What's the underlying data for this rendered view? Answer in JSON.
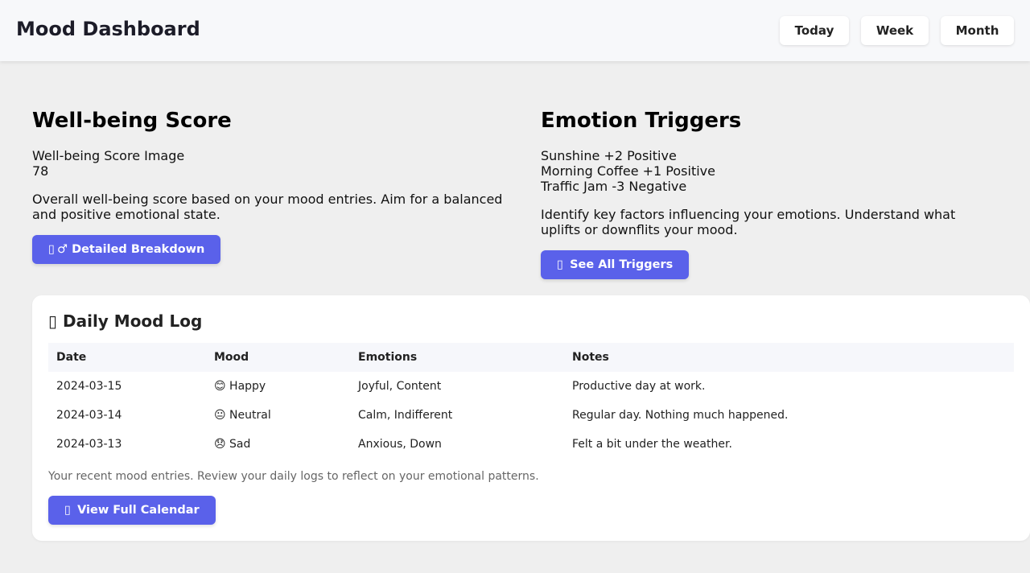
{
  "header": {
    "title": "Mood Dashboard",
    "periods": [
      "Today",
      "Week",
      "Month"
    ]
  },
  "wellbeing": {
    "title": "Well-being Score",
    "image_alt": "Well-being Score Image",
    "score": "78",
    "description": "Overall well-being score based on your mood entries. Aim for a balanced and positive emotional state.",
    "button_label": "Detailed Breakdown",
    "button_icon": "unrendered-emoji-man-icon"
  },
  "triggers": {
    "title": "Emotion Triggers",
    "items": [
      "Sunshine +2 Positive",
      "Morning Coffee +1 Positive",
      "Traffic Jam -3 Negative"
    ],
    "description": "Identify key factors influencing your emotions. Understand what uplifts or downflits your mood.",
    "button_label": "See All Triggers",
    "button_icon": "unrendered-emoji-icon"
  },
  "mood_log": {
    "title": "Daily Mood Log",
    "title_icon": "unrendered-emoji-icon",
    "columns": [
      "Date",
      "Mood",
      "Emotions",
      "Notes"
    ],
    "rows": [
      {
        "date": "2024-03-15",
        "mood": "😊 Happy",
        "emotions": "Joyful, Content",
        "notes": "Productive day at work."
      },
      {
        "date": "2024-03-14",
        "mood": "😐 Neutral",
        "emotions": "Calm, Indifferent",
        "notes": "Regular day. Nothing much happened."
      },
      {
        "date": "2024-03-13",
        "mood": "😞 Sad",
        "emotions": "Anxious, Down",
        "notes": "Felt a bit under the weather."
      }
    ],
    "caption": "Your recent mood entries. Review your daily logs to reflect on your emotional patterns.",
    "button_label": "View Full Calendar",
    "button_icon": "unrendered-emoji-icon"
  },
  "colors": {
    "accent": "#5a61ea",
    "page_background": "#efefef",
    "header_background": "#f7f8fa",
    "card_background": "#ffffff"
  }
}
